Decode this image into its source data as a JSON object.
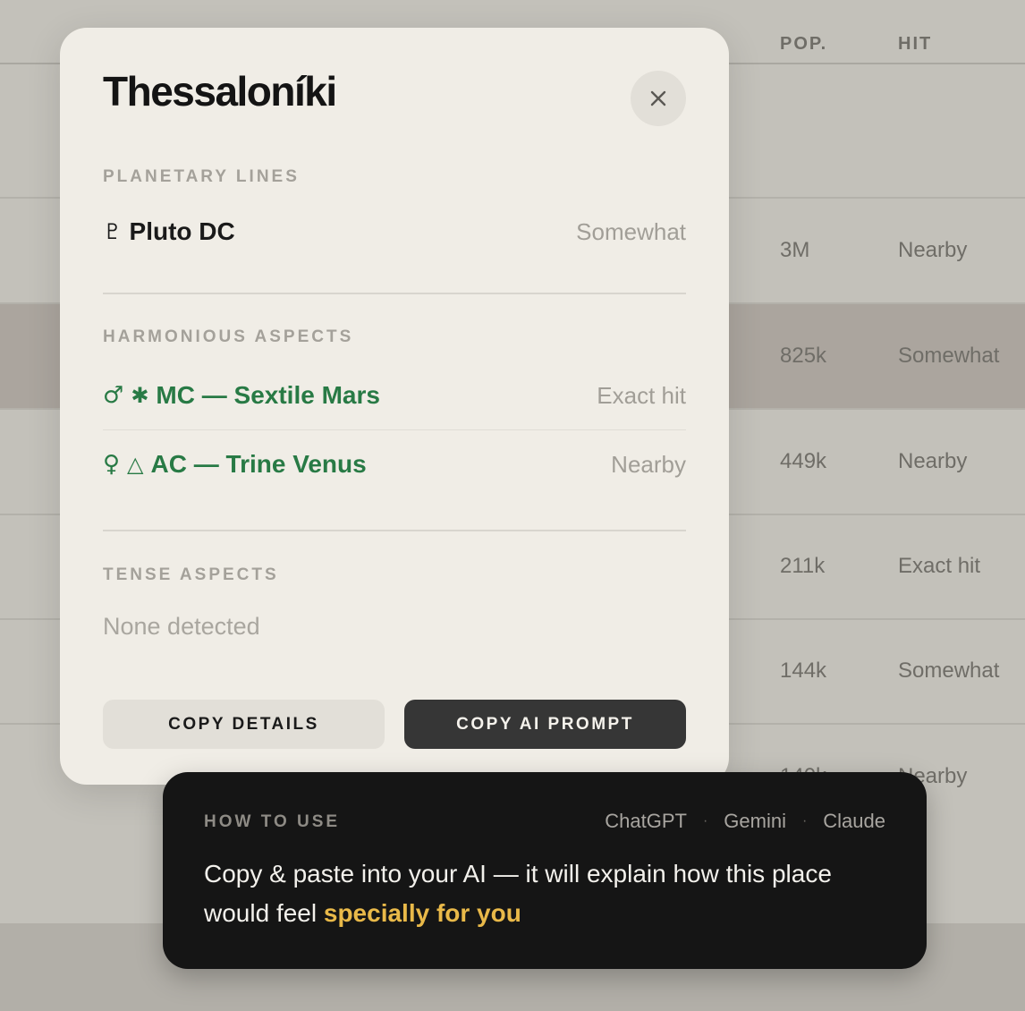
{
  "background_table": {
    "headers": [
      "POP.",
      "HIT"
    ],
    "rows": [
      {
        "pop": "",
        "hit": ""
      },
      {
        "pop": "3M",
        "hit": "Nearby"
      },
      {
        "pop": "825k",
        "hit": "Somewhat"
      },
      {
        "pop": "449k",
        "hit": "Nearby"
      },
      {
        "pop": "211k",
        "hit": "Exact hit"
      },
      {
        "pop": "144k",
        "hit": "Somewhat"
      },
      {
        "pop": "140k",
        "hit": "Nearby"
      }
    ],
    "selected_row": 2
  },
  "modal": {
    "title": "Thessaloníki",
    "close_icon": "close-icon",
    "planetary": {
      "label": "PLANETARY LINES",
      "items": [
        {
          "symbol": "♇",
          "name": "Pluto DC",
          "status": "Somewhat"
        }
      ]
    },
    "harmonious": {
      "label": "HARMONIOUS ASPECTS",
      "items": [
        {
          "planet_symbol": "♂",
          "aspect_symbol": "✱",
          "name": "MC — Sextile Mars",
          "status": "Exact hit"
        },
        {
          "planet_symbol": "♀",
          "aspect_symbol": "△",
          "name": "AC — Trine Venus",
          "status": "Nearby"
        }
      ]
    },
    "tense": {
      "label": "TENSE ASPECTS",
      "empty_text": "None detected"
    },
    "buttons": {
      "copy_details": "COPY DETAILS",
      "copy_ai_prompt": "COPY AI PROMPT"
    }
  },
  "tooltip": {
    "label": "HOW TO USE",
    "ais": [
      "ChatGPT",
      "Gemini",
      "Claude"
    ],
    "separator": "·",
    "body_prefix": "Copy & paste into your AI — it will explain how this place would feel ",
    "body_highlight": "specially for you"
  },
  "colors": {
    "harmonious_green": "#287a45",
    "highlight_yellow": "#e9b949",
    "dark_button": "#363636"
  }
}
